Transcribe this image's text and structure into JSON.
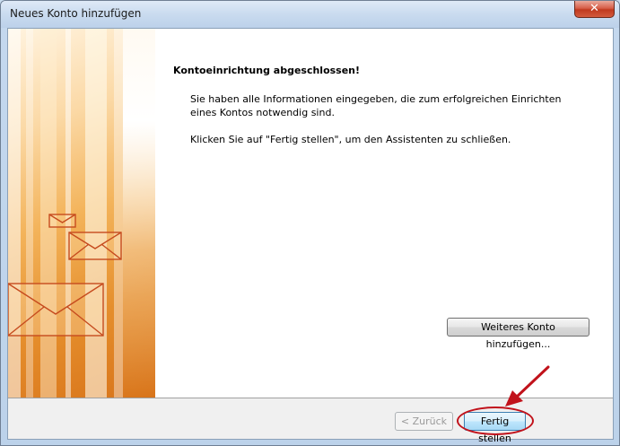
{
  "window": {
    "title": "Neues Konto hinzufügen",
    "close_glyph": "✕"
  },
  "content": {
    "heading": "Kontoeinrichtung abgeschlossen!",
    "paragraph1": "Sie haben alle Informationen eingegeben, die zum erfolgreichen Einrichten eines Kontos notwendig sind.",
    "paragraph2": "Klicken Sie auf \"Fertig stellen\", um den Assistenten zu schließen."
  },
  "buttons": {
    "more_account": "Weiteres Konto hinzufügen...",
    "back": "< Zurück",
    "finish": "Fertig stellen"
  },
  "colors": {
    "annotation": "#c1121b",
    "title_bar": "#c9dbef",
    "close_button": "#c0391f"
  },
  "icons": [
    "close-icon",
    "envelope-icon",
    "annotation-arrow"
  ]
}
